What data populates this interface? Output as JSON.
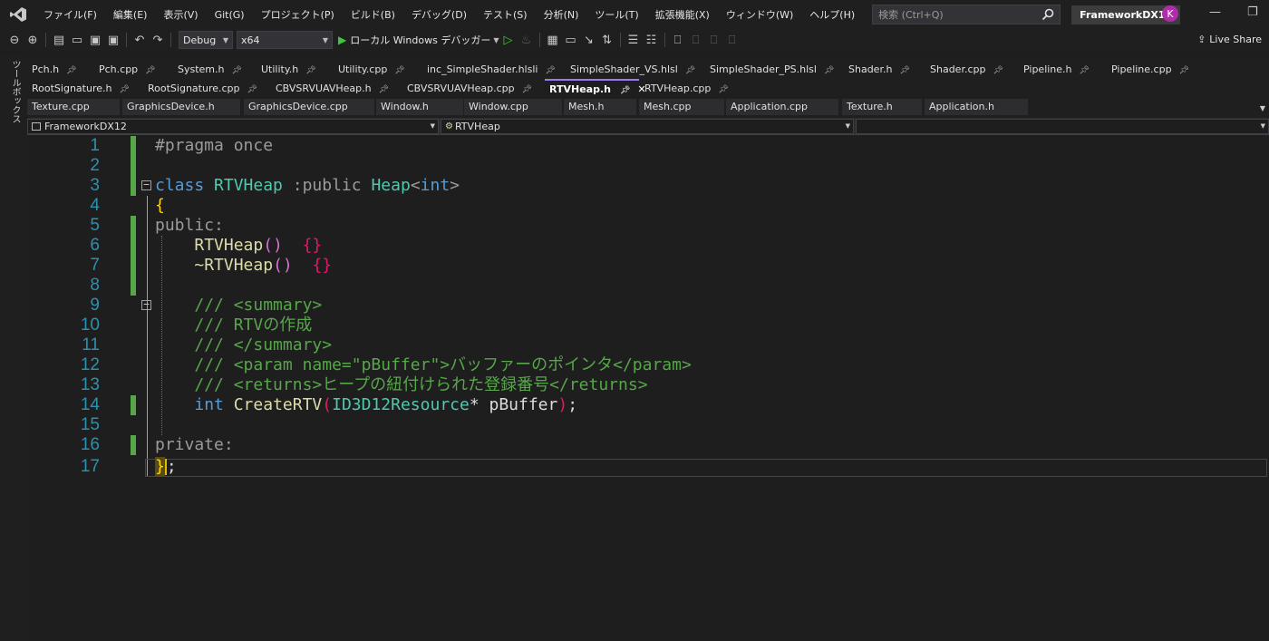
{
  "menu": {
    "items": [
      "ファイル(F)",
      "編集(E)",
      "表示(V)",
      "Git(G)",
      "プロジェクト(P)",
      "ビルド(B)",
      "デバッグ(D)",
      "テスト(S)",
      "分析(N)",
      "ツール(T)",
      "拡張機能(X)",
      "ウィンドウ(W)",
      "ヘルプ(H)"
    ],
    "search_placeholder": "検索 (Ctrl+Q)",
    "solution_name": "FrameworkDX12",
    "avatar_initial": "K"
  },
  "toolbar": {
    "config": "Debug",
    "platform": "x64",
    "run_label": "ローカル Windows デバッガー",
    "live_share": "Live Share"
  },
  "toolbox_label": "ツールボックス",
  "tabs": {
    "row1": [
      {
        "label": "Pch.h"
      },
      {
        "label": "Pch.cpp"
      },
      {
        "label": "System.h"
      },
      {
        "label": "Utility.h"
      },
      {
        "label": "Utility.cpp"
      },
      {
        "label": "inc_SimpleShader.hlsli"
      },
      {
        "label": "SimpleShader_VS.hlsl"
      },
      {
        "label": "SimpleShader_PS.hlsl"
      },
      {
        "label": "Shader.h"
      },
      {
        "label": "Shader.cpp"
      },
      {
        "label": "Pipeline.h"
      },
      {
        "label": "Pipeline.cpp"
      }
    ],
    "row2": [
      {
        "label": "RootSignature.h"
      },
      {
        "label": "RootSignature.cpp"
      },
      {
        "label": "CBVSRVUAVHeap.h"
      },
      {
        "label": "CBVSRVUAVHeap.cpp"
      },
      {
        "label": "RTVHeap.h"
      },
      {
        "label": "RTVHeap.cpp"
      }
    ],
    "row3": [
      {
        "label": "Texture.cpp"
      },
      {
        "label": "GraphicsDevice.h"
      },
      {
        "label": "GraphicsDevice.cpp"
      },
      {
        "label": "Window.h"
      },
      {
        "label": "Window.cpp"
      },
      {
        "label": "Mesh.h"
      },
      {
        "label": "Mesh.cpp"
      },
      {
        "label": "Application.cpp"
      },
      {
        "label": "Texture.h"
      },
      {
        "label": "Application.h"
      }
    ]
  },
  "navbar": {
    "project": "FrameworkDX12",
    "scope": "RTVHeap",
    "member": ""
  },
  "editor": {
    "line_numbers": [
      "1",
      "2",
      "3",
      "4",
      "5",
      "6",
      "7",
      "8",
      "9",
      "10",
      "11",
      "12",
      "13",
      "14",
      "15",
      "16",
      "17"
    ],
    "code": {
      "l1": "#pragma once",
      "l3_class": "class",
      "l3_name": "RTVHeap",
      "l3_colon": " :",
      "l3_public": "public",
      "l3_base": "Heap",
      "l3_lt": "<",
      "l3_int": "int",
      "l3_gt": ">",
      "l4": "{",
      "l5": "public:",
      "l6_name": "RTVHeap",
      "l6_parens": "()",
      "l6_body": "{}",
      "l7_name": "~RTVHeap",
      "l7_parens": "()",
      "l7_body": "{}",
      "l9": "/// <summary>",
      "l10": "/// RTVの作成",
      "l11": "/// </summary>",
      "l12": "/// <param name=\"pBuffer\">バッファーのポインタ</param>",
      "l13": "/// <returns>ヒープの紐付けられた登録番号</returns>",
      "l14_int": "int",
      "l14_fn": "CreateRTV",
      "l14_lp": "(",
      "l14_type": "ID3D12Resource",
      "l14_rest": "* pBuffer",
      "l14_rp": ")",
      "l14_semi": ";",
      "l16": "private:",
      "l17_brace": "}",
      "l17_semi": ";"
    }
  }
}
